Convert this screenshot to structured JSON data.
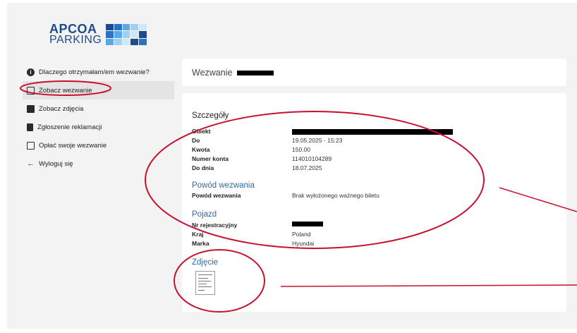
{
  "logo": {
    "line1": "APCOA",
    "line2": "PARKING",
    "grid_colors": [
      "#1d4b8c",
      "#2a73c4",
      "#5aa9e6",
      "#9fd0f2",
      "#cfe8f8"
    ]
  },
  "sidebar": {
    "items": [
      {
        "label": "Dlaczego otrzymałam/em wezwanie?",
        "icon": "info-icon"
      },
      {
        "label": "Zobacz wezwanie",
        "icon": "ticket-icon",
        "active": true
      },
      {
        "label": "Zobacz zdjęcia",
        "icon": "image-icon"
      },
      {
        "label": "Zgłoszenie reklamacji",
        "icon": "document-icon"
      },
      {
        "label": "Opłać swoje wezwanie",
        "icon": "card-icon"
      },
      {
        "label": "Wyloguj się",
        "icon": "arrow-left-icon"
      }
    ]
  },
  "header": {
    "title": "Wezwanie"
  },
  "details": {
    "title": "Szczegóły",
    "rows": [
      {
        "label": "Obiekt",
        "value": ""
      },
      {
        "label": "Do",
        "value": "19.05.2025 - 15:23"
      },
      {
        "label": "Kwota",
        "value": "150.00"
      },
      {
        "label": "Numer konta",
        "value": "114010104289"
      },
      {
        "label": "Do dnia",
        "value": "18.07.2025"
      }
    ]
  },
  "reason": {
    "title": "Powód wezwania",
    "rows": [
      {
        "label": "Powód wezwania",
        "value": "Brak wyłożonego ważnego biletu"
      }
    ]
  },
  "vehicle": {
    "title": "Pojazd",
    "rows": [
      {
        "label": "Nr rejestracyjny",
        "value": ""
      },
      {
        "label": "Kraj",
        "value": "Poland"
      },
      {
        "label": "Marka",
        "value": "Hyundai"
      }
    ]
  },
  "photo": {
    "title": "Zdjęcie"
  },
  "colors": {
    "accent_blue": "#2f6aa1",
    "annotation_red": "#c8102e",
    "active_nav_bg": "#e4e4e4"
  }
}
